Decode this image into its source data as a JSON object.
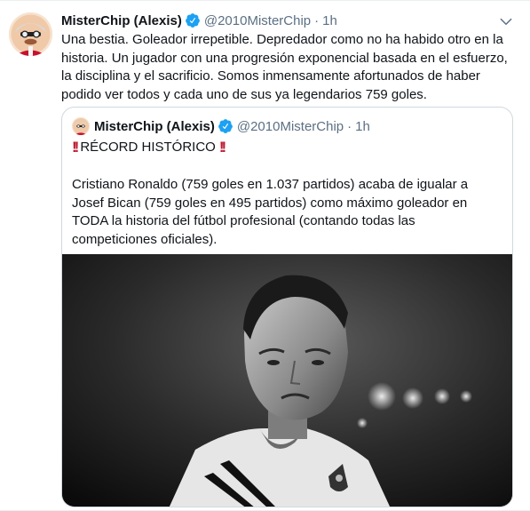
{
  "tweet": {
    "display_name": "MisterChip (Alexis)",
    "handle": "@2010MisterChip",
    "separator": "·",
    "time": "1h",
    "text": "Una bestia. Goleador irrepetible. Depredador como no ha habido otro en la historia. Un jugador con una progresión exponencial basada en el esfuerzo, la disciplina y el sacrificio. Somos inmensamente afortunados de haber podido ver todos y cada uno de sus ya legendarios 759 goles."
  },
  "quoted": {
    "display_name": "MisterChip (Alexis)",
    "handle": "@2010MisterChip",
    "separator": "·",
    "time": "1h",
    "title": "RÉCORD HISTÓRICO",
    "text": "Cristiano Ronaldo (759 goles en 1.037 partidos) acaba de igualar a Josef Bican (759 goles en 495 partidos) como máximo goleador en TODA la historia del fútbol profesional (contando todas las competiciones oficiales)."
  },
  "icons": {
    "verified": "verified-badge-icon",
    "caret": "chevron-down-icon",
    "emphasis": "double-exclamation-icon"
  },
  "colors": {
    "verified": "#1da1f2",
    "secondary_text": "#5b7083",
    "emphasis": "#be1931"
  }
}
